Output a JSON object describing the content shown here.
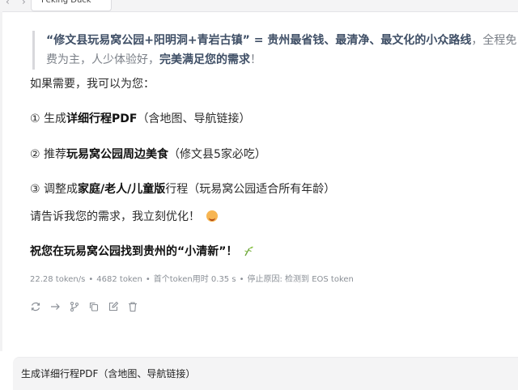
{
  "tab": {
    "title": "Peking Duck",
    "more": "···",
    "back": "‹",
    "forward": "›"
  },
  "quote": {
    "part1": "“修文县玩易窝公园+阳明洞+青岩古镇” = 贵州最省钱、最清净、最文化的小众路线",
    "part2": "，全程免费为主，人少体验好，",
    "part3": "完美满足您的需求",
    "part4": "！"
  },
  "intro": "如果需要，我可以为您：",
  "options": [
    {
      "num": "①",
      "pre": "生成",
      "bold": "详细行程PDF",
      "post": "（含地图、导航链接）"
    },
    {
      "num": "②",
      "pre": "推荐",
      "bold": "玩易窝公园周边美食",
      "post": "（修文县5家必吃）"
    },
    {
      "num": "③",
      "pre": "调整成",
      "bold": "家庭/老人/儿童版",
      "post": "行程（玩易窝公园适合所有年龄）"
    }
  ],
  "ask": "请告诉我您的需求，我立刻优化！",
  "blessing": "祝您在玩易窝公园找到贵州的“小清新”！",
  "meta": {
    "speed": "22.28 token/s",
    "tokens": "4682 token",
    "first": "首个token用时 0.35 s",
    "stop": "停止原因: 检测到 EOS token",
    "dot": "•"
  },
  "actions": [
    "refresh-icon",
    "forward-icon",
    "branch-icon",
    "copy-icon",
    "edit-icon",
    "delete-icon"
  ],
  "input": {
    "value": "生成详细行程PDF（含地图、导航链接）"
  },
  "colors": {
    "quote_highlight": "#3f4f66",
    "quote_text": "#7a7f87",
    "meta_text": "#8a8f96",
    "input_bg": "#f4f4f5"
  }
}
